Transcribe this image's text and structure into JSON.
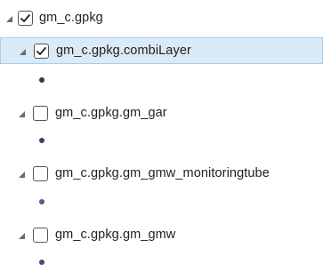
{
  "tree": {
    "root": {
      "label": "gm_c.gpkg",
      "checked": true,
      "expanded": true
    },
    "layers": [
      {
        "label": "gm_c.gpkg.combiLayer",
        "checked": true,
        "expanded": true,
        "selected": true,
        "symbol_color": "#2b3a55"
      },
      {
        "label": "gm_c.gpkg.gm_gar",
        "checked": false,
        "expanded": true,
        "selected": false,
        "symbol_color": "#2f4565"
      },
      {
        "label": "gm_c.gpkg.gm_gmw_monitoringtube",
        "checked": false,
        "expanded": true,
        "selected": false,
        "symbol_color": "#6a4f8a"
      },
      {
        "label": "gm_c.gpkg.gm_gmw",
        "checked": false,
        "expanded": true,
        "selected": false,
        "symbol_color": "#5d3f7d"
      }
    ]
  }
}
